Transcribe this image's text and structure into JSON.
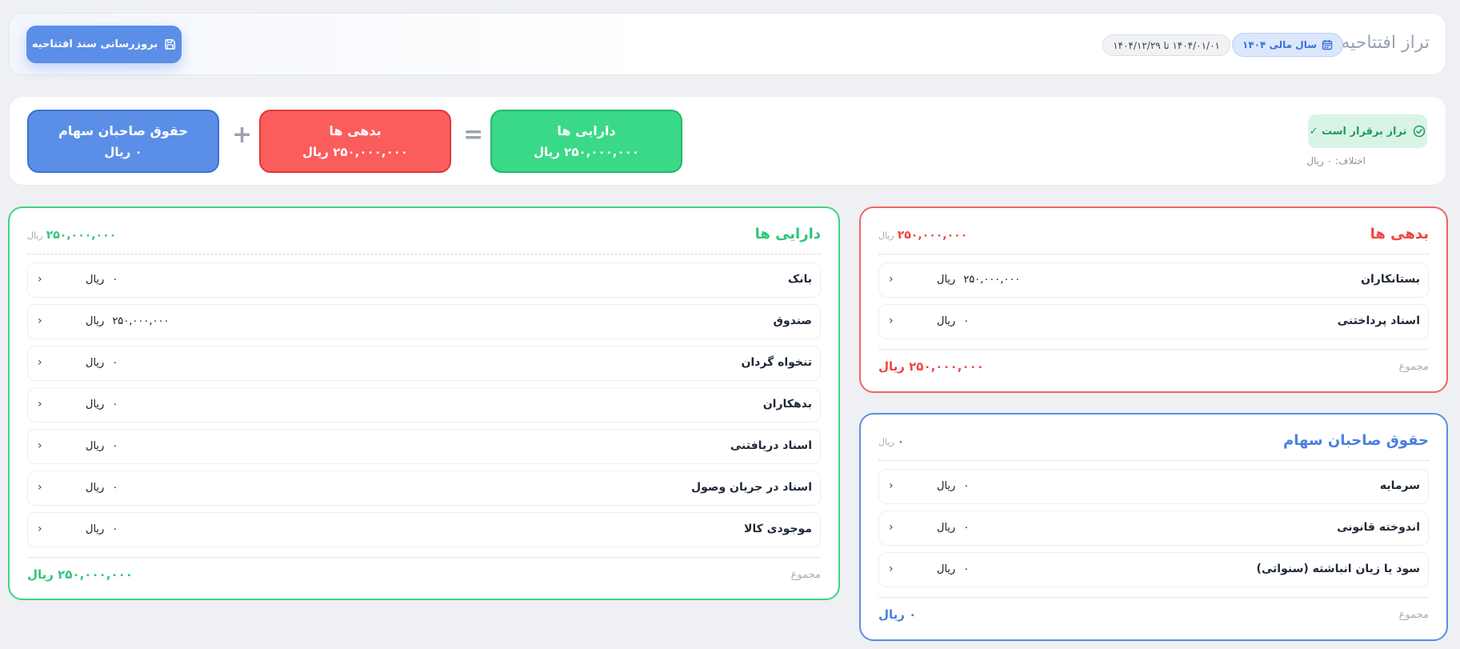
{
  "header": {
    "title": "تراز افتتاحیه",
    "fiscal_year": "سال مالی ۱۴۰۴",
    "date_range": "۱۴۰۴/۰۱/۰۱ تا ۱۴۰۴/۱۲/۲۹",
    "update_button": "بروزرسانی سند افتتاحیه",
    "icons": {
      "fiscal": "calendar-icon",
      "update": "save-icon"
    }
  },
  "summary": {
    "balance_status": "تراز برقرار است ✓",
    "difference": "اختلاف: ۰ ریال",
    "assets": {
      "title": "دارایی ها",
      "value": "۲۵۰,۰۰۰,۰۰۰ ریال"
    },
    "liabilities": {
      "title": "بدهی ها",
      "value": "۲۵۰,۰۰۰,۰۰۰ ریال"
    },
    "equity": {
      "title": "حقوق صاحبان سهام",
      "value": "۰ ریال"
    },
    "equals_sign": "=",
    "plus_sign": "+"
  },
  "assets": {
    "title": "دارایی ها",
    "total": "۲۵۰,۰۰۰,۰۰۰",
    "unit": "ریال",
    "rows": [
      {
        "name": "بانک",
        "amount": "۰",
        "unit": "ریال"
      },
      {
        "name": "صندوق",
        "amount": "۲۵۰,۰۰۰,۰۰۰",
        "unit": "ریال"
      },
      {
        "name": "تنخواه گردان",
        "amount": "۰",
        "unit": "ریال"
      },
      {
        "name": "بدهکاران",
        "amount": "۰",
        "unit": "ریال"
      },
      {
        "name": "اسناد دریافتنی",
        "amount": "۰",
        "unit": "ریال"
      },
      {
        "name": "اسناد در جریان وصول",
        "amount": "۰",
        "unit": "ریال"
      },
      {
        "name": "موجودی کالا",
        "amount": "۰",
        "unit": "ریال"
      }
    ],
    "footer_label": "مجموع",
    "footer_value": "۲۵۰,۰۰۰,۰۰۰ ریال"
  },
  "liabilities": {
    "title": "بدهی ها",
    "total": "۲۵۰,۰۰۰,۰۰۰",
    "unit": "ریال",
    "rows": [
      {
        "name": "بستانکاران",
        "amount": "۲۵۰,۰۰۰,۰۰۰",
        "unit": "ریال"
      },
      {
        "name": "اسناد پرداختنی",
        "amount": "۰",
        "unit": "ریال"
      }
    ],
    "footer_label": "مجموع",
    "footer_value": "۲۵۰,۰۰۰,۰۰۰ ریال"
  },
  "equity": {
    "title": "حقوق صاحبان سهام",
    "total": "۰",
    "unit": "ریال",
    "rows": [
      {
        "name": "سرمایه",
        "amount": "۰",
        "unit": "ریال"
      },
      {
        "name": "اندوخته قانونی",
        "amount": "۰",
        "unit": "ریال"
      },
      {
        "name": "سود یا زیان انباشته (سنواتی)",
        "amount": "۰",
        "unit": "ریال"
      }
    ],
    "footer_label": "مجموع",
    "footer_value": "۰ ریال"
  },
  "colors": {
    "assets": "#3ad988",
    "liabilities": "#fb5c5c",
    "equity": "#5b8ee6",
    "balanced": "#1f9d5c"
  }
}
